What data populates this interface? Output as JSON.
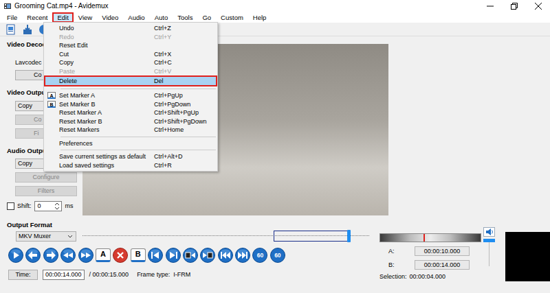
{
  "window": {
    "title": "Grooming Cat.mp4 - Avidemux"
  },
  "menubar": [
    {
      "label": "File",
      "selected": false
    },
    {
      "label": "Recent",
      "selected": false
    },
    {
      "label": "Edit",
      "selected": true
    },
    {
      "label": "View",
      "selected": false
    },
    {
      "label": "Video",
      "selected": false
    },
    {
      "label": "Audio",
      "selected": false
    },
    {
      "label": "Auto",
      "selected": false
    },
    {
      "label": "Tools",
      "selected": false
    },
    {
      "label": "Go",
      "selected": false
    },
    {
      "label": "Custom",
      "selected": false
    },
    {
      "label": "Help",
      "selected": false
    }
  ],
  "edit_menu": [
    {
      "kind": "item",
      "label": "Undo",
      "shortcut": "Ctrl+Z",
      "disabled": false,
      "selected": false
    },
    {
      "kind": "item",
      "label": "Redo",
      "shortcut": "Ctrl+Y",
      "disabled": true,
      "selected": false
    },
    {
      "kind": "item",
      "label": "Reset Edit",
      "disabled": false,
      "selected": false
    },
    {
      "kind": "item",
      "label": "Cut",
      "shortcut": "Ctrl+X",
      "disabled": false,
      "selected": false
    },
    {
      "kind": "item",
      "label": "Copy",
      "shortcut": "Ctrl+C",
      "disabled": false,
      "selected": false
    },
    {
      "kind": "item",
      "label": "Paste",
      "shortcut": "Ctrl+V",
      "disabled": true,
      "selected": false
    },
    {
      "kind": "item",
      "label": "Delete",
      "shortcut": "Del",
      "disabled": false,
      "selected": true
    },
    {
      "kind": "separator"
    },
    {
      "kind": "item",
      "label": "Set Marker A",
      "shortcut": "Ctrl+PgUp",
      "badge": "A",
      "disabled": false,
      "selected": false
    },
    {
      "kind": "item",
      "label": "Set Marker B",
      "shortcut": "Ctrl+PgDown",
      "badge": "B",
      "disabled": false,
      "selected": false
    },
    {
      "kind": "item",
      "label": "Reset Marker A",
      "shortcut": "Ctrl+Shift+PgUp",
      "disabled": false,
      "selected": false
    },
    {
      "kind": "item",
      "label": "Reset Marker B",
      "shortcut": "Ctrl+Shift+PgDown",
      "disabled": false,
      "selected": false
    },
    {
      "kind": "item",
      "label": "Reset Markers",
      "shortcut": "Ctrl+Home",
      "disabled": false,
      "selected": false
    },
    {
      "kind": "separator"
    },
    {
      "kind": "item",
      "label": "Preferences",
      "disabled": false,
      "selected": false
    },
    {
      "kind": "separator"
    },
    {
      "kind": "item",
      "label": "Save current settings as default",
      "shortcut": "Ctrl+Alt+D",
      "disabled": false,
      "selected": false
    },
    {
      "kind": "item",
      "label": "Load saved settings",
      "shortcut": "Ctrl+R",
      "disabled": false,
      "selected": false
    }
  ],
  "video_decoder": {
    "title": "Video Decoder",
    "codec": "Lavcodec",
    "button": {
      "label": "Co",
      "disabled": false
    }
  },
  "video_output": {
    "title": "Video Output",
    "value": "Copy",
    "buttons": [
      {
        "label": "Co",
        "disabled": true
      },
      {
        "label": "Fi",
        "disabled": true
      }
    ]
  },
  "audio_output": {
    "title": "Audio Output",
    "value": "Copy",
    "buttons": [
      {
        "label": "Configure",
        "disabled": true
      },
      {
        "label": "Filters",
        "disabled": true
      }
    ],
    "shift": {
      "label": "Shift:",
      "checked": false,
      "value": "0",
      "unit": "ms"
    }
  },
  "output_format": {
    "title": "Output Format",
    "muxer": "MKV Muxer"
  },
  "timeline": {
    "level": 0.933,
    "selection_start": 0.667,
    "selection_end": 0.933
  },
  "transport": [
    {
      "kind": "icon"
    },
    {
      "kind": "icon"
    },
    {
      "kind": "icon"
    },
    {
      "kind": "icon"
    },
    {
      "kind": "icon"
    },
    {
      "kind": "marker",
      "label": "A"
    },
    {
      "kind": "danger"
    },
    {
      "kind": "marker",
      "label": "B"
    },
    {
      "kind": "icon"
    },
    {
      "kind": "icon"
    },
    {
      "kind": "icon"
    },
    {
      "kind": "icon"
    },
    {
      "kind": "icon"
    },
    {
      "kind": "icon"
    },
    {
      "kind": "round",
      "label": "60"
    },
    {
      "kind": "round",
      "label": "60"
    }
  ],
  "shuttle": {
    "level": 0.43
  },
  "volume": {
    "level": 1
  },
  "markers": [
    {
      "label": "A:",
      "value": "00:00:10.000"
    },
    {
      "label": "B:",
      "value": "00:00:14.000"
    }
  ],
  "selection": {
    "label": "Selection:",
    "value": "00:00:04.000"
  },
  "status": {
    "time_button": "Time:",
    "time": "00:00:14.000",
    "total": "/ 00:00:15.000",
    "frame_type_label": "Frame type:",
    "frame_type": "I-FRM"
  }
}
